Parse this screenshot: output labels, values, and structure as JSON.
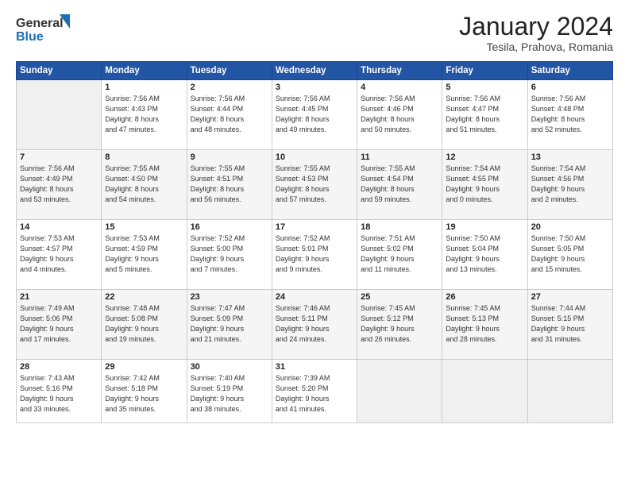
{
  "header": {
    "logo_line1": "General",
    "logo_line2": "Blue",
    "title": "January 2024",
    "subtitle": "Tesila, Prahova, Romania"
  },
  "days_of_week": [
    "Sunday",
    "Monday",
    "Tuesday",
    "Wednesday",
    "Thursday",
    "Friday",
    "Saturday"
  ],
  "weeks": [
    [
      {
        "day": "",
        "info": ""
      },
      {
        "day": "1",
        "info": "Sunrise: 7:56 AM\nSunset: 4:43 PM\nDaylight: 8 hours\nand 47 minutes."
      },
      {
        "day": "2",
        "info": "Sunrise: 7:56 AM\nSunset: 4:44 PM\nDaylight: 8 hours\nand 48 minutes."
      },
      {
        "day": "3",
        "info": "Sunrise: 7:56 AM\nSunset: 4:45 PM\nDaylight: 8 hours\nand 49 minutes."
      },
      {
        "day": "4",
        "info": "Sunrise: 7:56 AM\nSunset: 4:46 PM\nDaylight: 8 hours\nand 50 minutes."
      },
      {
        "day": "5",
        "info": "Sunrise: 7:56 AM\nSunset: 4:47 PM\nDaylight: 8 hours\nand 51 minutes."
      },
      {
        "day": "6",
        "info": "Sunrise: 7:56 AM\nSunset: 4:48 PM\nDaylight: 8 hours\nand 52 minutes."
      }
    ],
    [
      {
        "day": "7",
        "info": "Sunrise: 7:56 AM\nSunset: 4:49 PM\nDaylight: 8 hours\nand 53 minutes."
      },
      {
        "day": "8",
        "info": "Sunrise: 7:55 AM\nSunset: 4:50 PM\nDaylight: 8 hours\nand 54 minutes."
      },
      {
        "day": "9",
        "info": "Sunrise: 7:55 AM\nSunset: 4:51 PM\nDaylight: 8 hours\nand 56 minutes."
      },
      {
        "day": "10",
        "info": "Sunrise: 7:55 AM\nSunset: 4:53 PM\nDaylight: 8 hours\nand 57 minutes."
      },
      {
        "day": "11",
        "info": "Sunrise: 7:55 AM\nSunset: 4:54 PM\nDaylight: 8 hours\nand 59 minutes."
      },
      {
        "day": "12",
        "info": "Sunrise: 7:54 AM\nSunset: 4:55 PM\nDaylight: 9 hours\nand 0 minutes."
      },
      {
        "day": "13",
        "info": "Sunrise: 7:54 AM\nSunset: 4:56 PM\nDaylight: 9 hours\nand 2 minutes."
      }
    ],
    [
      {
        "day": "14",
        "info": "Sunrise: 7:53 AM\nSunset: 4:57 PM\nDaylight: 9 hours\nand 4 minutes."
      },
      {
        "day": "15",
        "info": "Sunrise: 7:53 AM\nSunset: 4:59 PM\nDaylight: 9 hours\nand 5 minutes."
      },
      {
        "day": "16",
        "info": "Sunrise: 7:52 AM\nSunset: 5:00 PM\nDaylight: 9 hours\nand 7 minutes."
      },
      {
        "day": "17",
        "info": "Sunrise: 7:52 AM\nSunset: 5:01 PM\nDaylight: 9 hours\nand 9 minutes."
      },
      {
        "day": "18",
        "info": "Sunrise: 7:51 AM\nSunset: 5:02 PM\nDaylight: 9 hours\nand 11 minutes."
      },
      {
        "day": "19",
        "info": "Sunrise: 7:50 AM\nSunset: 5:04 PM\nDaylight: 9 hours\nand 13 minutes."
      },
      {
        "day": "20",
        "info": "Sunrise: 7:50 AM\nSunset: 5:05 PM\nDaylight: 9 hours\nand 15 minutes."
      }
    ],
    [
      {
        "day": "21",
        "info": "Sunrise: 7:49 AM\nSunset: 5:06 PM\nDaylight: 9 hours\nand 17 minutes."
      },
      {
        "day": "22",
        "info": "Sunrise: 7:48 AM\nSunset: 5:08 PM\nDaylight: 9 hours\nand 19 minutes."
      },
      {
        "day": "23",
        "info": "Sunrise: 7:47 AM\nSunset: 5:09 PM\nDaylight: 9 hours\nand 21 minutes."
      },
      {
        "day": "24",
        "info": "Sunrise: 7:46 AM\nSunset: 5:11 PM\nDaylight: 9 hours\nand 24 minutes."
      },
      {
        "day": "25",
        "info": "Sunrise: 7:45 AM\nSunset: 5:12 PM\nDaylight: 9 hours\nand 26 minutes."
      },
      {
        "day": "26",
        "info": "Sunrise: 7:45 AM\nSunset: 5:13 PM\nDaylight: 9 hours\nand 28 minutes."
      },
      {
        "day": "27",
        "info": "Sunrise: 7:44 AM\nSunset: 5:15 PM\nDaylight: 9 hours\nand 31 minutes."
      }
    ],
    [
      {
        "day": "28",
        "info": "Sunrise: 7:43 AM\nSunset: 5:16 PM\nDaylight: 9 hours\nand 33 minutes."
      },
      {
        "day": "29",
        "info": "Sunrise: 7:42 AM\nSunset: 5:18 PM\nDaylight: 9 hours\nand 35 minutes."
      },
      {
        "day": "30",
        "info": "Sunrise: 7:40 AM\nSunset: 5:19 PM\nDaylight: 9 hours\nand 38 minutes."
      },
      {
        "day": "31",
        "info": "Sunrise: 7:39 AM\nSunset: 5:20 PM\nDaylight: 9 hours\nand 41 minutes."
      },
      {
        "day": "",
        "info": ""
      },
      {
        "day": "",
        "info": ""
      },
      {
        "day": "",
        "info": ""
      }
    ]
  ]
}
